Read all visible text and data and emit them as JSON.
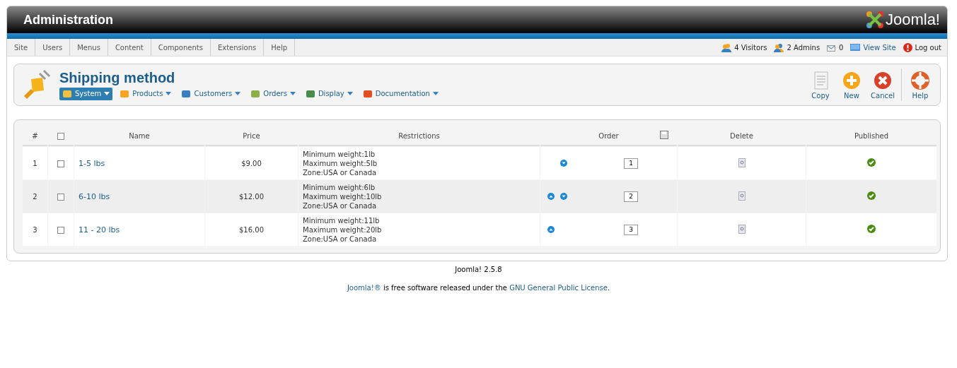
{
  "header": {
    "title": "Administration",
    "logo": "Joomla!"
  },
  "menu": [
    "Site",
    "Users",
    "Menus",
    "Content",
    "Components",
    "Extensions",
    "Help"
  ],
  "status": [
    {
      "kind": "visitors",
      "label": "4 Visitors"
    },
    {
      "kind": "admins",
      "label": "2 Admins"
    },
    {
      "kind": "messages",
      "label": "0"
    },
    {
      "kind": "viewsite",
      "label": "View Site"
    },
    {
      "kind": "logout",
      "label": "Log out"
    }
  ],
  "page_title": "Shipping method",
  "submenu": [
    {
      "kind": "system",
      "label": "System",
      "selected": true
    },
    {
      "kind": "products",
      "label": "Products",
      "selected": false
    },
    {
      "kind": "customers",
      "label": "Customers",
      "selected": false
    },
    {
      "kind": "orders",
      "label": "Orders",
      "selected": false
    },
    {
      "kind": "display",
      "label": "Display",
      "selected": false
    },
    {
      "kind": "documentation",
      "label": "Documentation",
      "selected": false
    }
  ],
  "toolbar": [
    {
      "kind": "copy",
      "label": "Copy"
    },
    {
      "kind": "new",
      "label": "New"
    },
    {
      "kind": "cancel",
      "label": "Cancel"
    },
    {
      "kind": "help",
      "label": "Help"
    }
  ],
  "table": {
    "columns": [
      "#",
      "Name",
      "Price",
      "Restrictions",
      "Order",
      "Delete",
      "Published"
    ],
    "header_checked": false,
    "rows": [
      {
        "num": "1",
        "checked": false,
        "name": "1-5 lbs",
        "price": "$9.00",
        "restrictions": [
          "Minimum weight:1lb",
          "Maximum weight:5lb",
          "Zone:USA or Canada"
        ],
        "can_move_up": false,
        "can_move_down": true,
        "order": "1",
        "published": true
      },
      {
        "num": "2",
        "checked": false,
        "name": "6-10 lbs",
        "price": "$12.00",
        "restrictions": [
          "Minimum weight:6lb",
          "Maximum weight:10lb",
          "Zone:USA or Canada"
        ],
        "can_move_up": true,
        "can_move_down": true,
        "order": "2",
        "published": true
      },
      {
        "num": "3",
        "checked": false,
        "name": "11 - 20 lbs",
        "price": "$16.00",
        "restrictions": [
          "Minimum weight:11lb",
          "Maximum weight:20lb",
          "Zone:USA or Canada"
        ],
        "can_move_up": true,
        "can_move_down": false,
        "order": "3",
        "published": true
      }
    ]
  },
  "footer": {
    "version": "Joomla! 2.5.8",
    "license": [
      {
        "kind": "link",
        "text": "Joomla!®"
      },
      {
        "kind": "text",
        "text": " is free software released under the "
      },
      {
        "kind": "link",
        "text": "GNU General Public License"
      },
      {
        "kind": "text",
        "text": "."
      }
    ]
  }
}
